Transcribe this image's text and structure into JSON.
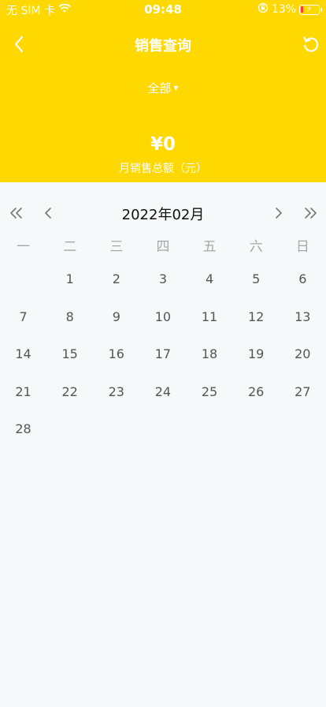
{
  "status_bar": {
    "carrier": "无 SIM 卡",
    "time": "09:48",
    "battery": "13%",
    "battery_percent": 13
  },
  "header": {
    "title": "销售查询",
    "filter_label": "全部",
    "amount": "¥0",
    "amount_label": "月销售总额（元）",
    "background_color": "#ffd800"
  },
  "calendar": {
    "month_label": "2022年02月",
    "weekdays": [
      "一",
      "二",
      "三",
      "四",
      "五",
      "六",
      "日"
    ],
    "weeks": [
      [
        "",
        "1",
        "2",
        "3",
        "4",
        "5",
        "6"
      ],
      [
        "7",
        "8",
        "9",
        "10",
        "11",
        "12",
        "13"
      ],
      [
        "14",
        "15",
        "16",
        "17",
        "18",
        "19",
        "20"
      ],
      [
        "21",
        "22",
        "23",
        "24",
        "25",
        "26",
        "27"
      ],
      [
        "28",
        "",
        "",
        "",
        "",
        "",
        ""
      ]
    ]
  },
  "icons": {
    "back": "chevron-left-icon",
    "refresh": "refresh-icon",
    "prev_year": "double-chevron-left-icon",
    "prev_month": "chevron-left-icon",
    "next_month": "chevron-right-icon",
    "next_year": "double-chevron-right-icon",
    "wifi": "wifi-icon",
    "orientation_lock": "orientation-lock-icon",
    "battery": "battery-icon"
  }
}
